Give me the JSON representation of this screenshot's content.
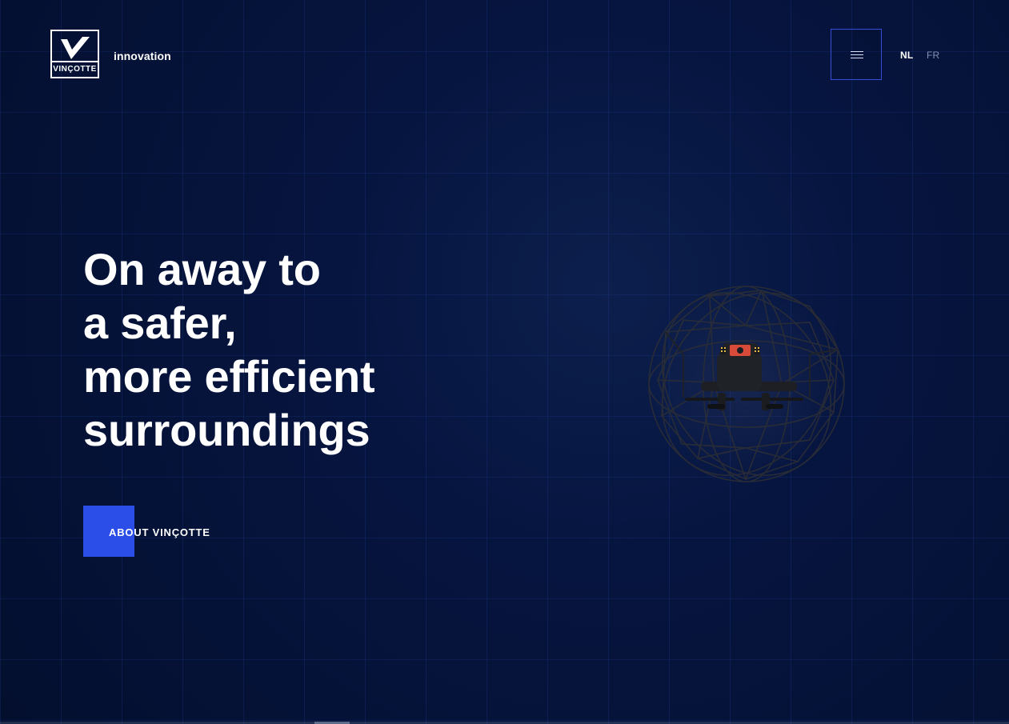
{
  "brand": {
    "logo_word": "VINÇOTTE",
    "subtitle": "innovation"
  },
  "navigation": {
    "menu_icon": "hamburger-icon",
    "languages": [
      "NL",
      "FR"
    ],
    "active_language": "NL"
  },
  "hero": {
    "title_lines": [
      "On away to",
      "a safer,",
      "more efficient",
      "surroundings"
    ],
    "cta_label": "ABOUT VINÇOTTE"
  },
  "visual": {
    "image": "caged-drone"
  },
  "theme": {
    "background": "#061540",
    "accent": "#2b4ee8",
    "grid_line": "#2e58be",
    "text": "#ffffff",
    "muted_text": "#8491b7"
  }
}
